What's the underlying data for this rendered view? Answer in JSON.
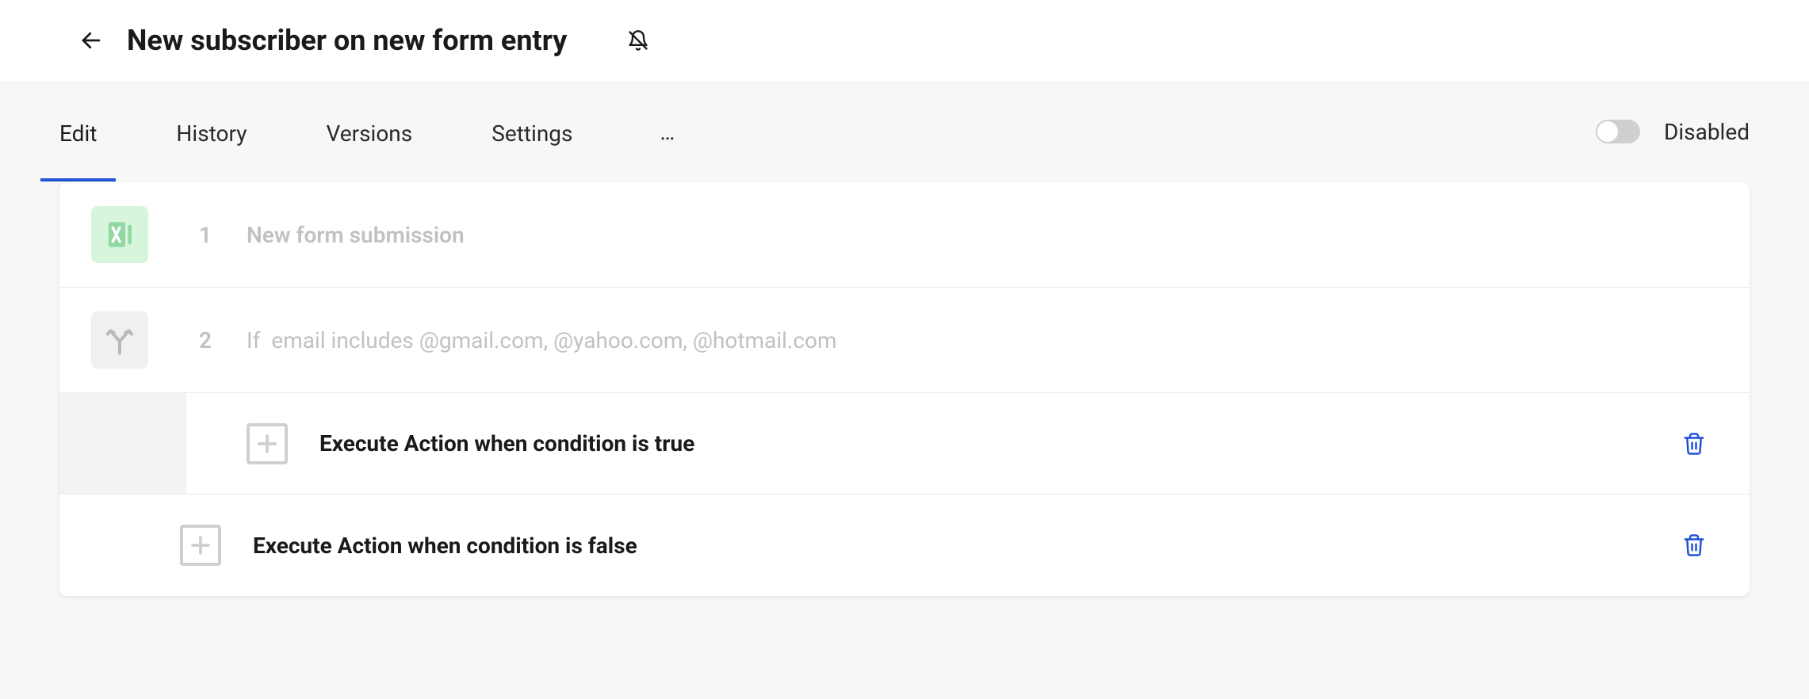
{
  "header": {
    "title": "New subscriber on new form entry"
  },
  "tabs": {
    "items": [
      "Edit",
      "History",
      "Versions",
      "Settings"
    ],
    "more": "…",
    "active_index": 0
  },
  "status": {
    "enabled": false,
    "label": "Disabled"
  },
  "workflow": {
    "steps": [
      {
        "index": "1",
        "label": "New form submission",
        "icon": "form",
        "icon_style": "green"
      },
      {
        "index": "2",
        "prefix": "If",
        "condition": "email includes @gmail.com, @yahoo.com, @hotmail.com",
        "icon": "branch",
        "icon_style": "gray"
      }
    ],
    "branches": [
      {
        "label": "Execute Action when condition is true",
        "indented": true
      },
      {
        "label": "Execute Action when condition is false",
        "indented": false
      }
    ]
  },
  "colors": {
    "accent": "#2053d8",
    "muted_text": "#c1c1c1",
    "bg_page": "#f7f7f7",
    "icon_green_bg": "#d7f4dd"
  }
}
